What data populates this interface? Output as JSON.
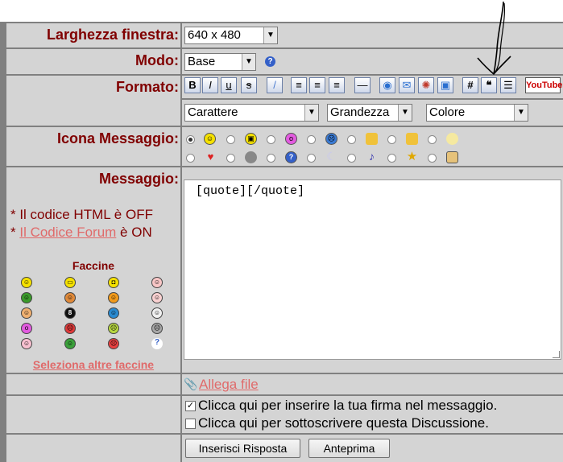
{
  "window": {
    "label": "Larghezza finestra:",
    "value": "640 x 480"
  },
  "mode": {
    "label": "Modo:",
    "value": "Base"
  },
  "format": {
    "label": "Formato:",
    "font_value": "Carattere",
    "size_value": "Grandezza",
    "color_value": "Colore",
    "youtube_label": "YouTube"
  },
  "icon": {
    "label": "Icona Messaggio:",
    "selected_index": 0
  },
  "message": {
    "label": "Messaggio:",
    "body": "[quote][/quote]",
    "html_code_prefix": "* Il codice HTML è ",
    "html_status": "OFF",
    "forum_code_prefix": "* ",
    "forum_code_link": "Il Codice Forum",
    "forum_code_suffix": " è ON"
  },
  "smileys": {
    "title": "Faccine",
    "more_link": "Seleziona altre faccine"
  },
  "attach": {
    "label": "Allega file"
  },
  "options": {
    "signature_label": "Clicca qui per inserire la tua firma nel messaggio.",
    "signature_checked": true,
    "subscribe_label": "Clicca qui per sottoscrivere questa Discussione.",
    "subscribe_checked": false
  },
  "buttons": {
    "submit_label": "Inserisci Risposta",
    "preview_label": "Anteprima"
  },
  "colors": {
    "label_text": "#800000",
    "link_text": "#e06a6a",
    "cell_background": "#d4d4d4",
    "border": "#808080",
    "annotation_stroke": "#000000"
  }
}
